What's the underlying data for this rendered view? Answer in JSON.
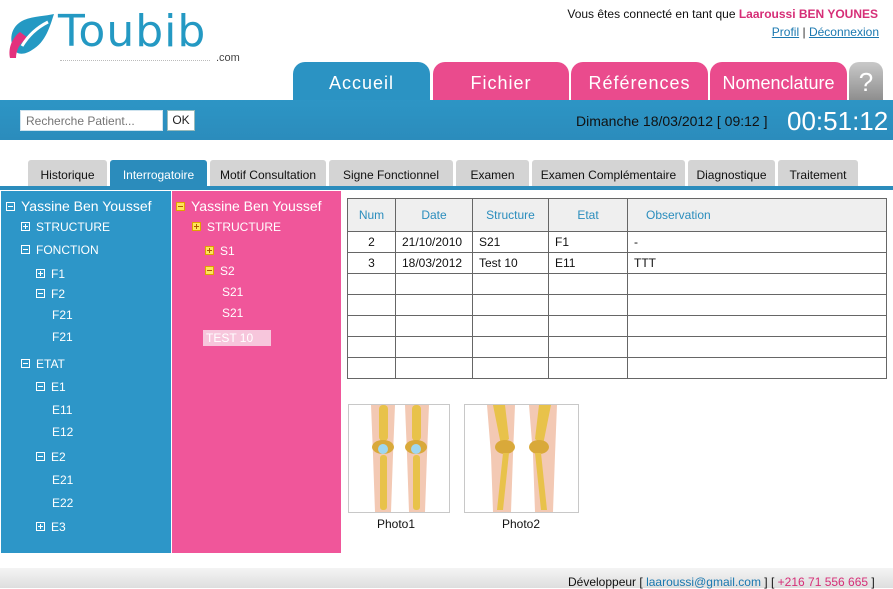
{
  "header": {
    "logo_text": "Toubib",
    "logo_domain": ".com",
    "connected_prefix": "Vous êtes connecté en tant que",
    "user_name": "Laaroussi BEN YOUNES",
    "profile_link": "Profil",
    "separator": "|",
    "logout_link": "Déconnexion"
  },
  "main_tabs": [
    {
      "label": "Accueil"
    },
    {
      "label": "Fichier"
    },
    {
      "label": "Références"
    },
    {
      "label": "Nomenclature"
    }
  ],
  "help_label": "?",
  "search": {
    "placeholder": "Recherche Patient...",
    "button_label": "OK"
  },
  "date_text": "Dimanche 18/03/2012 [ 09:12 ]",
  "clock": "00:51:12",
  "sub_tabs": [
    {
      "label": "Historique"
    },
    {
      "label": "Interrogatoire"
    },
    {
      "label": "Motif Consultation"
    },
    {
      "label": "Signe Fonctionnel"
    },
    {
      "label": "Examen"
    },
    {
      "label": "Examen Complémentaire"
    },
    {
      "label": "Diagnostique"
    },
    {
      "label": "Traitement"
    }
  ],
  "active_sub_tab": "Interrogatoire",
  "tree_blue": {
    "root": "Yassine Ben Youssef",
    "items": [
      "STRUCTURE",
      "FONCTION",
      "F1",
      "F2",
      "F21",
      "F21",
      "ETAT",
      "E1",
      "E11",
      "E12",
      "E2",
      "E21",
      "E22",
      "E3"
    ]
  },
  "tree_pink": {
    "root": "Yassine Ben Youssef",
    "items": [
      "STRUCTURE",
      "S1",
      "S2",
      "S21",
      "S21",
      "TEST 10"
    ]
  },
  "table": {
    "headers": [
      "Num",
      "Date",
      "Structure",
      "Etat",
      "Observation"
    ],
    "rows": [
      [
        "2",
        "21/10/2010",
        "S21",
        "F1",
        "-"
      ],
      [
        "3",
        "18/03/2012",
        "Test 10",
        "E11",
        "TTT"
      ],
      [
        "",
        "",
        "",
        "",
        ""
      ],
      [
        "",
        "",
        "",
        "",
        ""
      ],
      [
        "",
        "",
        "",
        "",
        ""
      ],
      [
        "",
        "",
        "",
        "",
        ""
      ],
      [
        "",
        "",
        "",
        "",
        ""
      ]
    ]
  },
  "photos": [
    {
      "caption": "Photo1"
    },
    {
      "caption": "Photo2"
    }
  ],
  "footer": {
    "prefix": "Développeur [",
    "email": "laaroussi@gmail.com",
    "middle": "] [",
    "phone": "+216 71 556 665",
    "suffix": "]"
  },
  "colors": {
    "blue": "#2b8cbc",
    "pink": "#ea4b8d",
    "user": "#d62e77"
  }
}
